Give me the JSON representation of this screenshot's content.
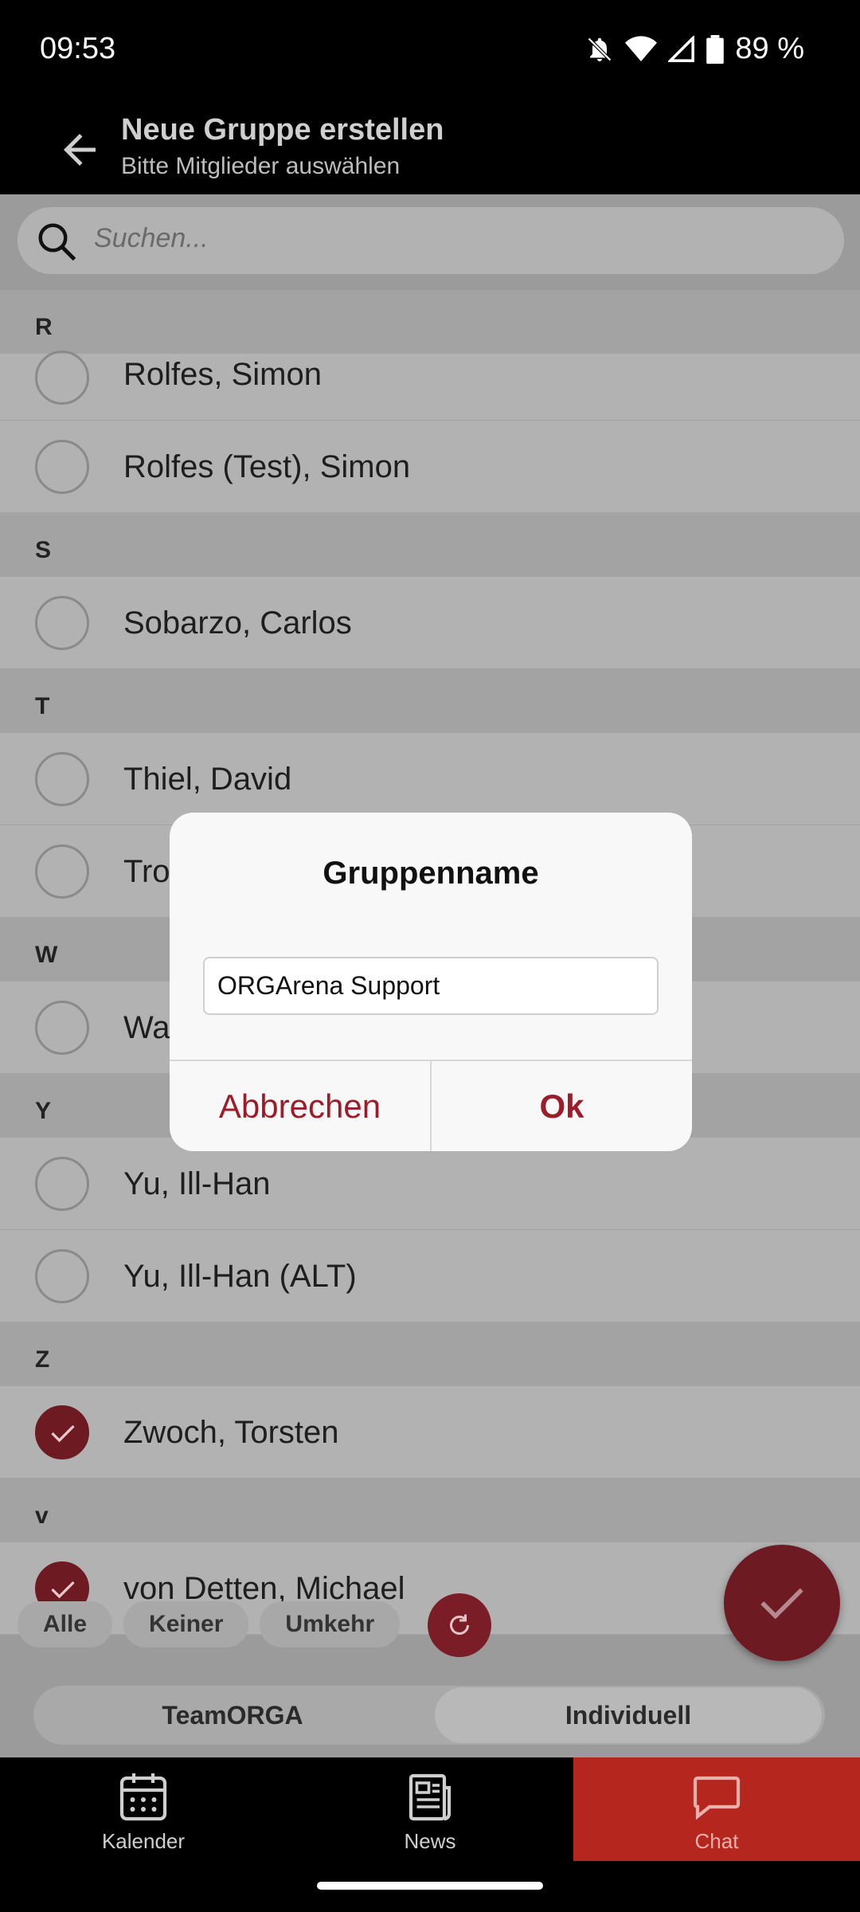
{
  "status": {
    "time": "09:53",
    "battery": "89 %"
  },
  "appbar": {
    "title": "Neue Gruppe erstellen",
    "subtitle": "Bitte Mitglieder auswählen"
  },
  "search": {
    "placeholder": "Suchen..."
  },
  "sections": [
    {
      "letter": "R",
      "rows": [
        {
          "name": "Rolfes, Simon",
          "checked": false
        },
        {
          "name": "Rolfes (Test), Simon",
          "checked": false
        }
      ]
    },
    {
      "letter": "S",
      "rows": [
        {
          "name": "Sobarzo, Carlos",
          "checked": false
        }
      ]
    },
    {
      "letter": "T",
      "rows": [
        {
          "name": "Thiel, David",
          "checked": false
        },
        {
          "name": "Tro",
          "checked": false
        }
      ]
    },
    {
      "letter": "W",
      "rows": [
        {
          "name": "Wa",
          "checked": false
        }
      ]
    },
    {
      "letter": "Y",
      "rows": [
        {
          "name": "Yu, Ill-Han",
          "checked": false
        },
        {
          "name": "Yu, Ill-Han (ALT)",
          "checked": false
        }
      ]
    },
    {
      "letter": "Z",
      "rows": [
        {
          "name": "Zwoch, Torsten",
          "checked": true
        }
      ]
    },
    {
      "letter": "v",
      "rows": [
        {
          "name": "von Detten, Michael",
          "checked": true
        }
      ]
    }
  ],
  "chips": {
    "all": "Alle",
    "none": "Keiner",
    "invert": "Umkehr"
  },
  "segment": {
    "left": "TeamORGA",
    "right": "Individuell",
    "selected": "right"
  },
  "nav": {
    "calendar": "Kalender",
    "news": "News",
    "chat": "Chat",
    "active": "chat"
  },
  "dialog": {
    "title": "Gruppenname",
    "input_value": "ORGArena Support",
    "cancel": "Abbrechen",
    "ok": "Ok"
  },
  "colors": {
    "accent": "#9c1d2a",
    "checked": "#6e1a23",
    "nav_active": "#b5261e"
  }
}
